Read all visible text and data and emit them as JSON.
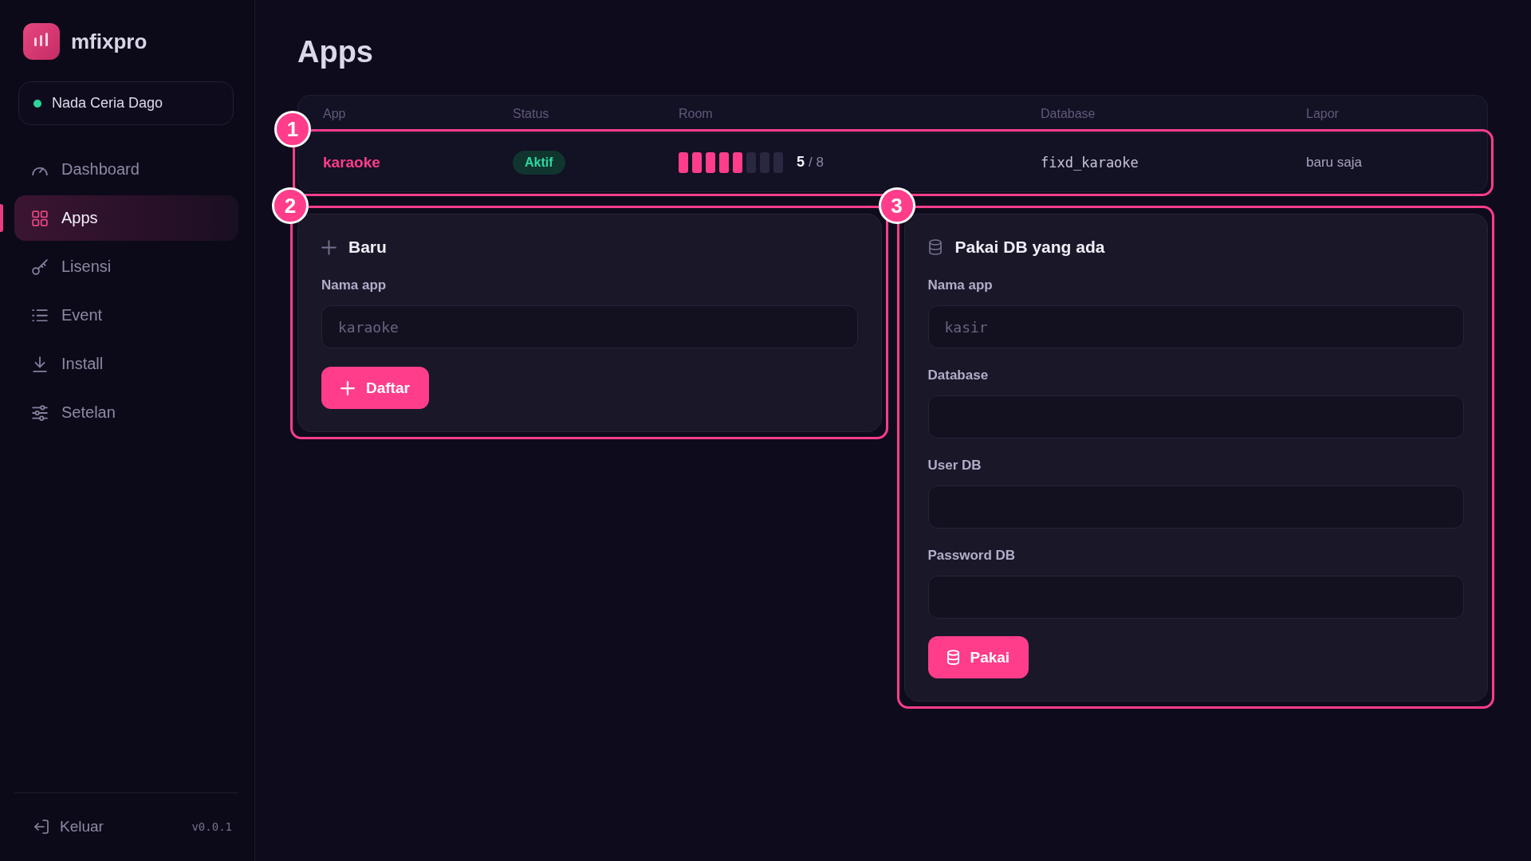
{
  "sidebar": {
    "brand": "mfixpro",
    "workspace": {
      "name": "Nada Ceria Dago",
      "online": true
    },
    "nav": [
      {
        "label": "Dashboard",
        "selected": false
      },
      {
        "label": "Apps",
        "selected": true
      },
      {
        "label": "Lisensi",
        "selected": false
      },
      {
        "label": "Event",
        "selected": false
      },
      {
        "label": "Install",
        "selected": false
      },
      {
        "label": "Setelan",
        "selected": false
      }
    ],
    "footer": {
      "logout": "Keluar",
      "version": "v0.0.1"
    }
  },
  "page": {
    "title": "Apps"
  },
  "table": {
    "columns": [
      "App",
      "Status",
      "Room",
      "Database",
      "Lapor"
    ],
    "rows": [
      {
        "callout": "1",
        "app": "karaoke",
        "status": "Aktif",
        "active": true,
        "room": {
          "level": 0.625,
          "count": "5",
          "total": "/ 8"
        },
        "database": "fixd_karaoke",
        "report": "baru saja"
      }
    ]
  },
  "new_app": {
    "callout": "2",
    "title": "Baru",
    "field": {
      "label": "Nama app",
      "placeholder": "karaoke"
    },
    "button": "Daftar"
  },
  "existing_db": {
    "callout": "3",
    "title": "Pakai DB yang ada",
    "fields": [
      {
        "label": "Nama app",
        "placeholder": "kasir"
      },
      {
        "label": "Database"
      },
      {
        "label": "User DB"
      },
      {
        "label": "Password DB"
      }
    ],
    "button": "Pakai"
  }
}
